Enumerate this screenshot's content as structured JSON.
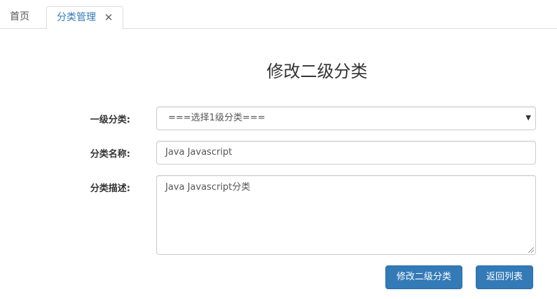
{
  "tabs": {
    "home_label": "首页",
    "active_label": "分类管理",
    "close_glyph": "✕"
  },
  "page": {
    "title": "修改二级分类"
  },
  "form": {
    "parent_category_label": "一级分类:",
    "parent_category_value": "===选择1级分类===",
    "name_label": "分类名称:",
    "name_value": "Java Javascript",
    "description_label": "分类描述:",
    "description_value": "Java Javascript分类"
  },
  "buttons": {
    "submit_label": "修改二级分类",
    "back_label": "返回列表"
  },
  "colors": {
    "accent": "#337ab7",
    "border": "#cccccc"
  }
}
